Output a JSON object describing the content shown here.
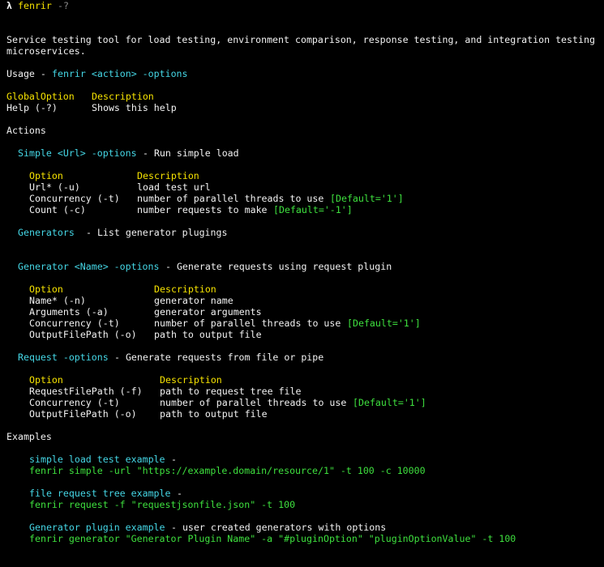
{
  "prompt": {
    "symbol": "λ",
    "command": "fenrir",
    "args": "-?"
  },
  "description": "Service testing tool for load testing, environment comparison, response testing, and integration testing",
  "description_cont": "microservices.",
  "usage": {
    "label": "Usage - ",
    "cmd": "fenrir <action> -options"
  },
  "global": {
    "col1": "GlobalOption",
    "col2": "Description",
    "rows": [
      {
        "opt": "Help (-?)",
        "desc": "Shows this help"
      }
    ]
  },
  "actions_title": "Actions",
  "simple": {
    "name": "Simple <Url> -options",
    "desc": " - Run simple load",
    "col1": "Option",
    "col2": "Description",
    "rows": [
      {
        "opt": "Url* (-u)",
        "desc": "load test url",
        "def": ""
      },
      {
        "opt": "Concurrency (-t)",
        "desc": "number of parallel threads to use ",
        "def": "[Default='1']"
      },
      {
        "opt": "Count (-c)",
        "desc": "number requests to make ",
        "def": "[Default='-1']"
      }
    ]
  },
  "generators": {
    "name": "Generators ",
    "desc": " - List generator plugings"
  },
  "generator": {
    "name": "Generator <Name> -options",
    "desc": " - Generate requests using request plugin",
    "col1": "Option",
    "col2": "Description",
    "rows": [
      {
        "opt": "Name* (-n)",
        "desc": "generator name",
        "def": ""
      },
      {
        "opt": "Arguments (-a)",
        "desc": "generator arguments",
        "def": ""
      },
      {
        "opt": "Concurrency (-t)",
        "desc": "number of parallel threads to use ",
        "def": "[Default='1']"
      },
      {
        "opt": "OutputFilePath (-o)",
        "desc": "path to output file",
        "def": ""
      }
    ]
  },
  "request": {
    "name": "Request -options",
    "desc": " - Generate requests from file or pipe",
    "col1": "Option",
    "col2": "Description",
    "rows": [
      {
        "opt": "RequestFilePath (-f)",
        "desc": "path to request tree file",
        "def": ""
      },
      {
        "opt": "Concurrency (-t)",
        "desc": "number of parallel threads to use ",
        "def": "[Default='1']"
      },
      {
        "opt": "OutputFilePath (-o)",
        "desc": "path to output file",
        "def": ""
      }
    ]
  },
  "examples_title": "Examples",
  "examples": [
    {
      "title": "simple load test example",
      "suffix": " -",
      "cmd": "fenrir simple -url \"https://example.domain/resource/1\" -t 100 -c 10000"
    },
    {
      "title": "file request tree example",
      "suffix": " -",
      "cmd": "fenrir request -f \"requestjsonfile.json\" -t 100"
    },
    {
      "title": "Generator plugin example",
      "suffix": " - user created generators with options",
      "cmd": "fenrir generator \"Generator Plugin Name\" -a \"#pluginOption\" \"pluginOptionValue\" -t 100"
    }
  ],
  "colors": {
    "background": "#000000",
    "text": "#f2f2f2",
    "yellow": "#f5e200",
    "cyan": "#45d7e6",
    "green": "#3ee03e",
    "muted": "#8a8a8a"
  }
}
